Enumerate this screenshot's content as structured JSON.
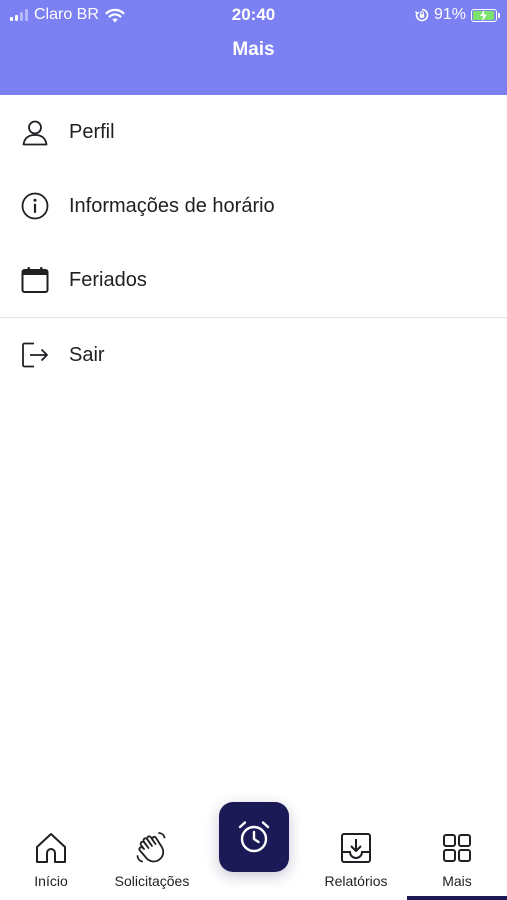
{
  "status_bar": {
    "carrier": "Claro BR",
    "time": "20:40",
    "battery_percent": "91%",
    "battery_level": 0.91,
    "icons": [
      "signal-icon",
      "wifi-icon",
      "orientation-lock-icon",
      "battery-charging-icon"
    ]
  },
  "header": {
    "title": "Mais",
    "background_color": "#7b80f2"
  },
  "menu": {
    "items": [
      {
        "label": "Perfil",
        "icon": "user-icon"
      },
      {
        "label": "Informações de horário",
        "icon": "info-icon"
      },
      {
        "label": "Feriados",
        "icon": "calendar-icon"
      },
      {
        "label": "Sair",
        "icon": "logout-icon"
      }
    ]
  },
  "bottom_nav": {
    "items": [
      {
        "label": "Início",
        "icon": "home-icon",
        "active": false
      },
      {
        "label": "Solicitações",
        "icon": "wave-hand-icon",
        "active": false
      },
      {
        "label": "Relatórios",
        "icon": "download-tray-icon",
        "active": false
      },
      {
        "label": "Mais",
        "icon": "grid-icon",
        "active": true
      }
    ],
    "fab_icon": "alarm-clock-icon",
    "accent_color": "#1b1a57"
  }
}
